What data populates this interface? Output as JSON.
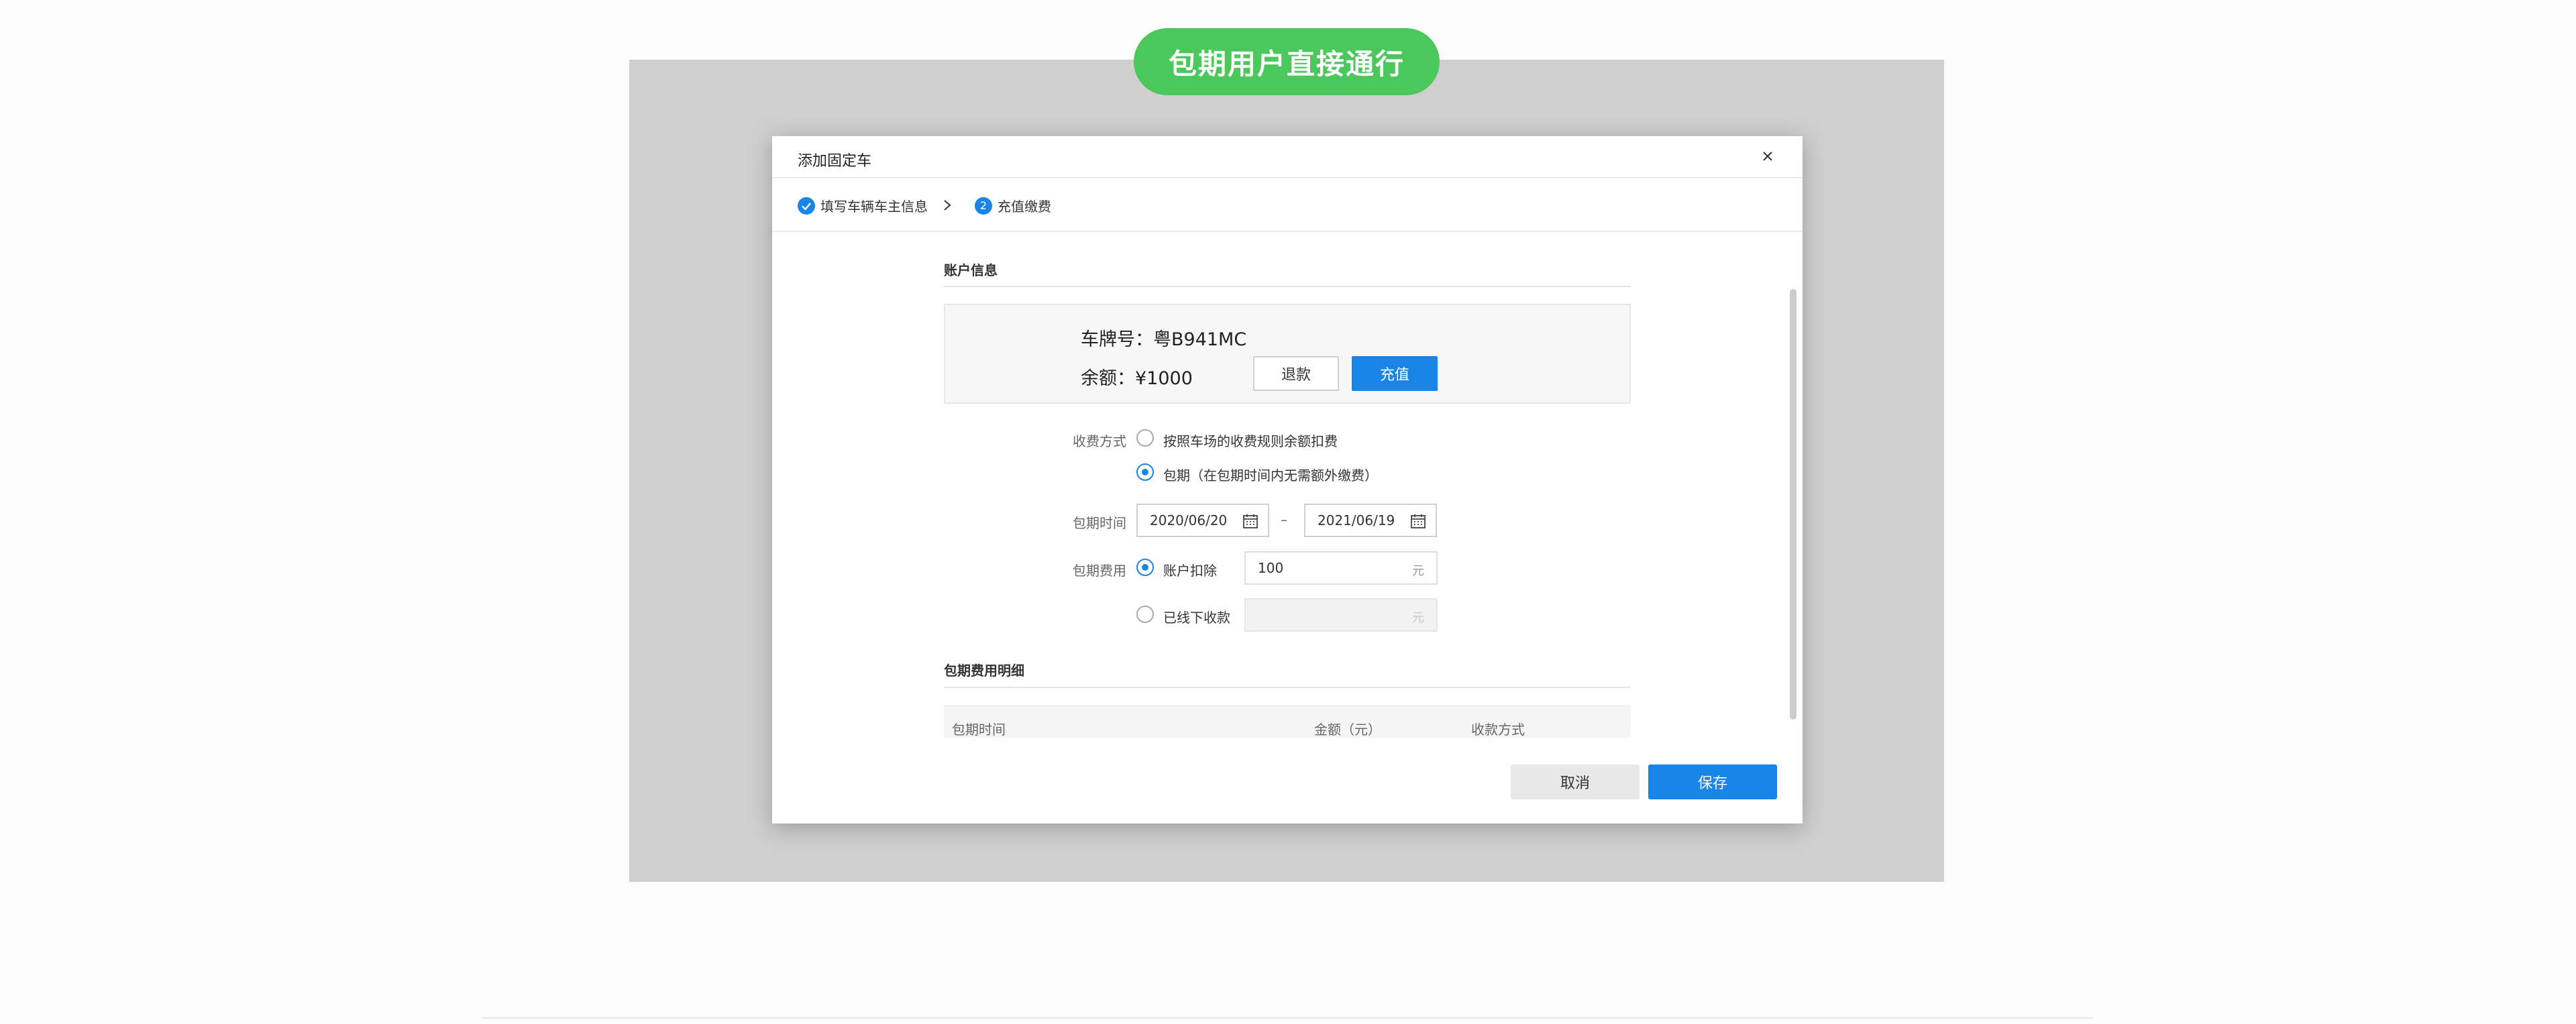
{
  "banner": {
    "text": "包期用户直接通行",
    "color": "#4bc75b"
  },
  "modal": {
    "title": "添加固定车",
    "steps": [
      {
        "label": "填写车辆车主信息",
        "state": "done"
      },
      {
        "label": "充值缴费",
        "number": "2",
        "state": "active"
      }
    ],
    "account_section": "账户信息",
    "plate": "车牌号：粤B941MC",
    "balance": "余额：¥1000",
    "refund_label": "退款",
    "recharge_label": "充值",
    "charge_mode": {
      "label": "收费方式",
      "options": [
        {
          "text": "按照车场的收费规则余额扣费",
          "checked": false
        },
        {
          "text": "包期（在包期时间内无需额外缴费）",
          "checked": true
        }
      ]
    },
    "period": {
      "label": "包期时间",
      "start": "2020/06/20",
      "separator": "–",
      "end": "2021/06/19"
    },
    "fee": {
      "label": "包期费用",
      "options": [
        {
          "text": "账户扣除",
          "checked": true,
          "value": "100",
          "unit": "元"
        },
        {
          "text": "已线下收款",
          "checked": false,
          "value": "",
          "unit": "元"
        }
      ]
    },
    "detail_section": "包期费用明细",
    "table_headers": [
      "包期时间",
      "金额（元）",
      "收款方式"
    ],
    "cancel_label": "取消",
    "save_label": "保存",
    "accent_color": "#1a85e6"
  }
}
